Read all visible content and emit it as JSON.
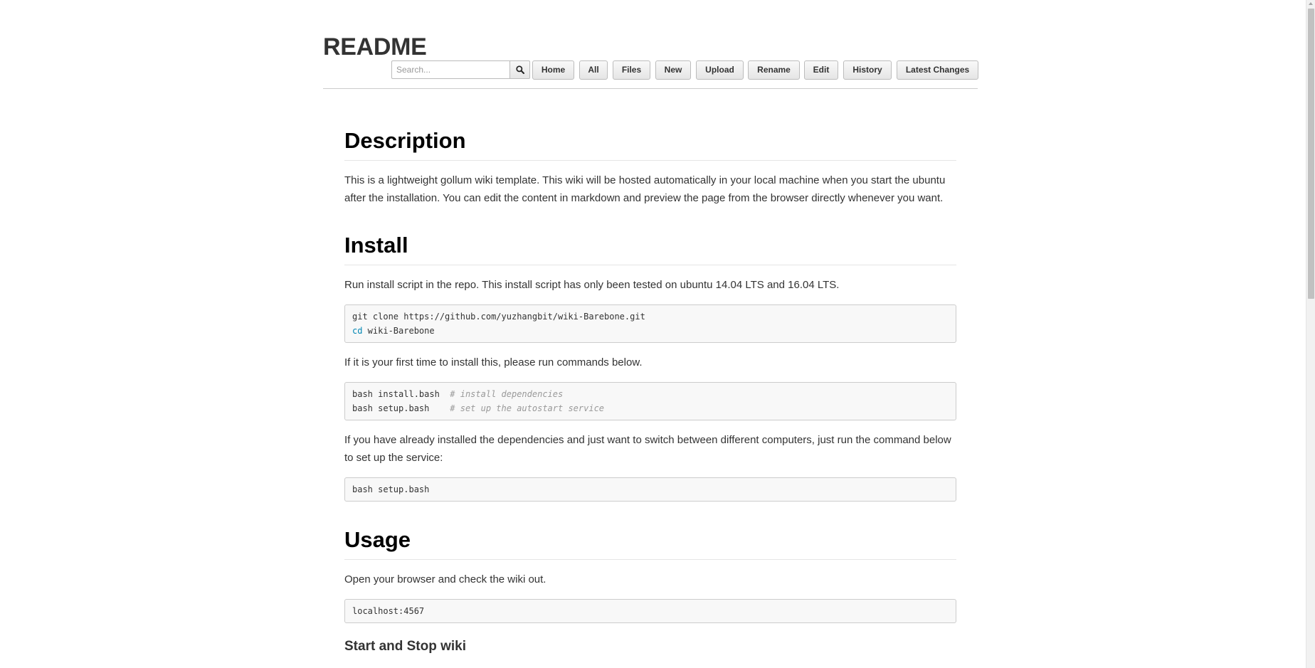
{
  "title": "README",
  "search": {
    "placeholder": "Search..."
  },
  "nav": {
    "home": "Home",
    "all": "All",
    "files": "Files",
    "new": "New",
    "upload": "Upload",
    "rename": "Rename",
    "edit": "Edit",
    "history": "History",
    "latest_changes": "Latest Changes"
  },
  "content": {
    "description": {
      "heading": "Description",
      "text": "This is a lightweight gollum wiki template. This wiki will be hosted automatically in your local machine when you start the ubuntu after the installation. You can edit the content in markdown and preview the page from the browser directly whenever you want."
    },
    "install": {
      "heading": "Install",
      "text1": "Run install script in the repo. This install script has only been tested on ubuntu 14.04 LTS and 16.04 LTS.",
      "code1_line1": "git clone https://github.com/yuzhangbit/wiki-Barebone.git",
      "code1_line2_kw": "cd",
      "code1_line2_rest": " wiki-Barebone",
      "text2": "If it is your first time to install this, please run commands below.",
      "code2_line1_cmd": "bash install.bash  ",
      "code2_line1_cmt": "# install dependencies",
      "code2_line2_cmd": "bash setup.bash    ",
      "code2_line2_cmt": "# set up the autostart service",
      "text3": "If you have already installed the dependencies and just want to switch between different computers, just run the command below to set up the service:",
      "code3": "bash setup.bash"
    },
    "usage": {
      "heading": "Usage",
      "text": "Open your browser and check the wiki out.",
      "code": "localhost:4567",
      "subheading": "Start and Stop wiki"
    }
  },
  "colors": {
    "code_keyword": "#0086b3",
    "code_comment": "#999999",
    "code_background": "#f8f8f8"
  }
}
